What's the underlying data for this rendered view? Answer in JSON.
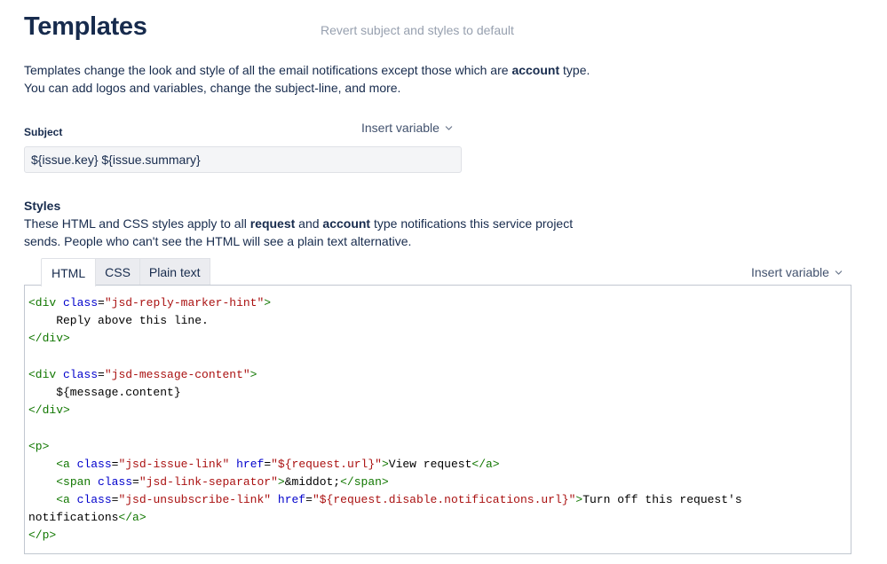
{
  "header": {
    "title": "Templates",
    "revert_link": "Revert subject and styles to default"
  },
  "description": {
    "part1": "Templates change the look and style of all the email notifications except those which are ",
    "bold": "account",
    "part2": " type. You can add logos and variables, change the subject-line, and more."
  },
  "subject": {
    "label": "Subject",
    "insert_variable": "Insert variable",
    "value": "${issue.key} ${issue.summary}"
  },
  "styles": {
    "title": "Styles",
    "desc_part1": "These HTML and CSS styles apply to all ",
    "desc_bold1": "request",
    "desc_part2": " and ",
    "desc_bold2": "account",
    "desc_part3": " type notifications this service project sends. People who can't see the HTML will see a plain text alternative.",
    "insert_variable": "Insert variable",
    "tabs": [
      "HTML",
      "CSS",
      "Plain text"
    ],
    "active_tab": "HTML"
  },
  "code_lines": [
    [
      [
        "tg",
        "<div "
      ],
      [
        "at",
        "class"
      ],
      [
        "tx",
        "="
      ],
      [
        "st",
        "\"jsd-reply-marker-hint\""
      ],
      [
        "tg",
        ">"
      ]
    ],
    [
      [
        "tx",
        "    Reply above this line."
      ]
    ],
    [
      [
        "tg",
        "</div>"
      ]
    ],
    [],
    [
      [
        "tg",
        "<div "
      ],
      [
        "at",
        "class"
      ],
      [
        "tx",
        "="
      ],
      [
        "st",
        "\"jsd-message-content\""
      ],
      [
        "tg",
        ">"
      ]
    ],
    [
      [
        "tx",
        "    ${message.content}"
      ]
    ],
    [
      [
        "tg",
        "</div>"
      ]
    ],
    [],
    [
      [
        "tg",
        "<p>"
      ]
    ],
    [
      [
        "tx",
        "    "
      ],
      [
        "tg",
        "<a "
      ],
      [
        "at",
        "class"
      ],
      [
        "tx",
        "="
      ],
      [
        "st",
        "\"jsd-issue-link\""
      ],
      [
        "tx",
        " "
      ],
      [
        "at",
        "href"
      ],
      [
        "tx",
        "="
      ],
      [
        "st",
        "\"${request.url}\""
      ],
      [
        "tg",
        ">"
      ],
      [
        "tx",
        "View request"
      ],
      [
        "tg",
        "</a>"
      ]
    ],
    [
      [
        "tx",
        "    "
      ],
      [
        "tg",
        "<span "
      ],
      [
        "at",
        "class"
      ],
      [
        "tx",
        "="
      ],
      [
        "st",
        "\"jsd-link-separator\""
      ],
      [
        "tg",
        ">"
      ],
      [
        "tx",
        "&middot;"
      ],
      [
        "tg",
        "</span>"
      ]
    ],
    [
      [
        "tx",
        "    "
      ],
      [
        "tg",
        "<a "
      ],
      [
        "at",
        "class"
      ],
      [
        "tx",
        "="
      ],
      [
        "st",
        "\"jsd-unsubscribe-link\""
      ],
      [
        "tx",
        " "
      ],
      [
        "at",
        "href"
      ],
      [
        "tx",
        "="
      ],
      [
        "st",
        "\"${request.disable.notifications.url}\""
      ],
      [
        "tg",
        ">"
      ],
      [
        "tx",
        "Turn off this request's"
      ]
    ],
    [
      [
        "tx",
        "notifications"
      ],
      [
        "tg",
        "</a>"
      ]
    ],
    [
      [
        "tg",
        "</p>"
      ]
    ]
  ]
}
